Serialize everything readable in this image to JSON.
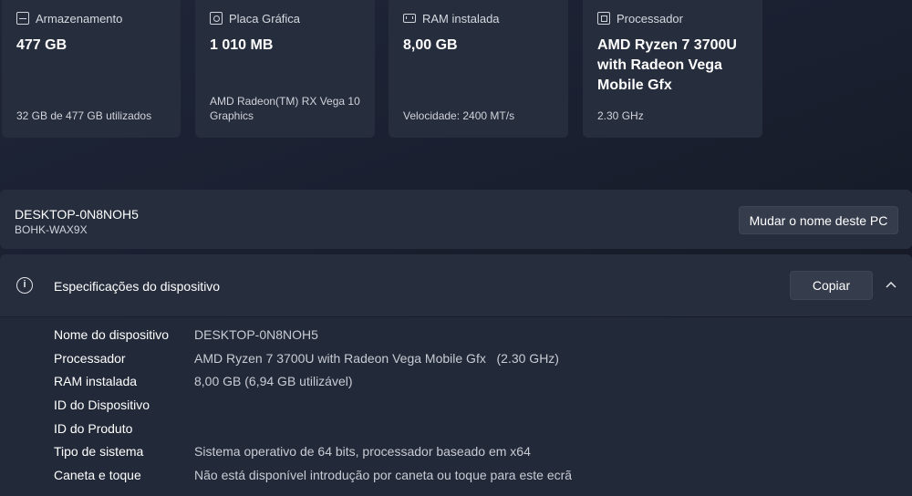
{
  "cards": [
    {
      "icon": "storage-icon",
      "title": "Armazenamento",
      "value": "477 GB",
      "footer": "32 GB de 477 GB utilizados"
    },
    {
      "icon": "graphics-card-icon",
      "title": "Placa Gráfica",
      "value": "1 010 MB",
      "footer": "AMD Radeon(TM) RX Vega 10 Graphics"
    },
    {
      "icon": "ram-icon",
      "title": "RAM instalada",
      "value": "8,00 GB",
      "footer": "Velocidade: 2400 MT/s"
    },
    {
      "icon": "processor-icon",
      "title": "Processador",
      "value": "AMD Ryzen 7 3700U with Radeon Vega Mobile Gfx",
      "footer": "2.30 GHz"
    }
  ],
  "device": {
    "name": "DESKTOP-0N8NOH5",
    "model": "BOHK-WAX9X",
    "rename_label": "Mudar o nome deste PC"
  },
  "specs": {
    "title": "Especificações do dispositivo",
    "copy_label": "Copiar",
    "rows": [
      {
        "label": "Nome do dispositivo",
        "value": "DESKTOP-0N8NOH5"
      },
      {
        "label": "Processador",
        "value": "AMD Ryzen 7 3700U with Radeon Vega Mobile Gfx   (2.30 GHz)"
      },
      {
        "label": "RAM instalada",
        "value": "8,00 GB (6,94 GB utilizável)"
      },
      {
        "label": "ID do Dispositivo",
        "value": ""
      },
      {
        "label": "ID do Produto",
        "value": ""
      },
      {
        "label": "Tipo de sistema",
        "value": "Sistema operativo de 64 bits, processador baseado em x64"
      },
      {
        "label": "Caneta e toque",
        "value": "Não está disponível introdução por caneta ou toque para este ecrã"
      }
    ]
  },
  "colors": {
    "card_bg": "#262d3d",
    "page_bg": "#1a2030",
    "button_bg": "#353c4c"
  }
}
